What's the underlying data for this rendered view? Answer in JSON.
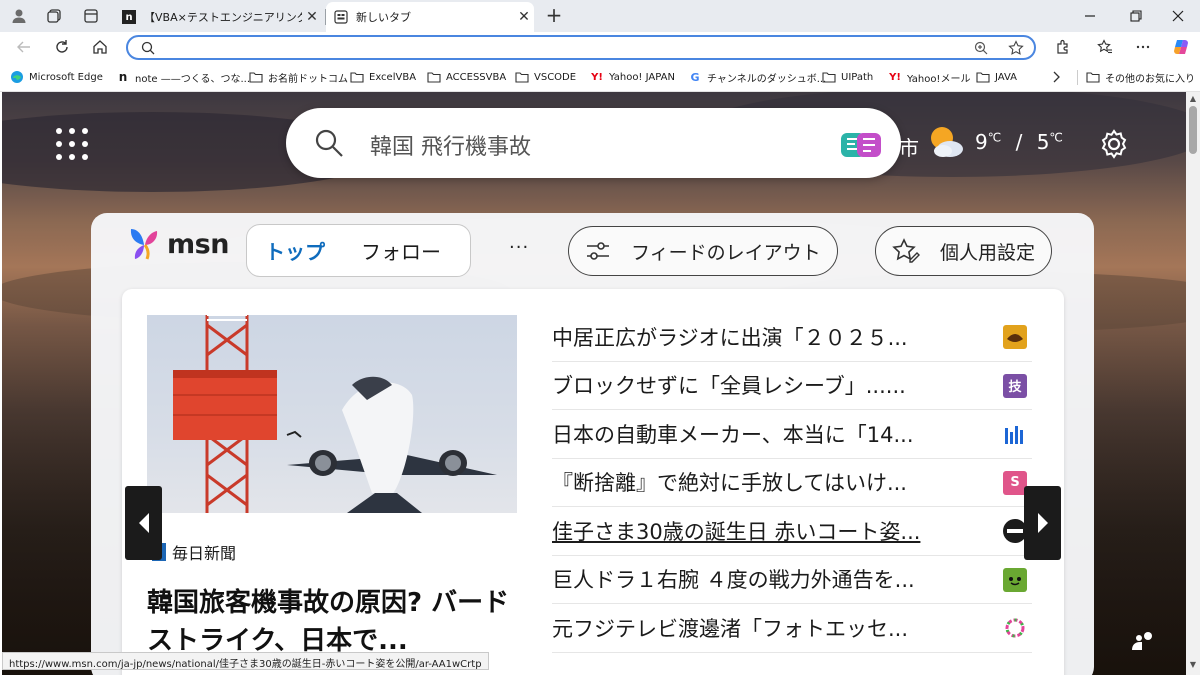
{
  "tabs": [
    {
      "title": "【VBA×テストエンジニアリング】エビデ",
      "active": false,
      "favicon": "n"
    },
    {
      "title": "新しいタブ",
      "active": true
    }
  ],
  "toolbar": {
    "address_value": "",
    "address_placeholder": ""
  },
  "bookmarks": [
    {
      "label": "Microsoft Edge",
      "icon": "edge-icon"
    },
    {
      "label": "note ——つくる、つな...",
      "icon": "note-icon"
    },
    {
      "label": "お名前ドットコム",
      "icon": "folder-icon"
    },
    {
      "label": "ExcelVBA",
      "icon": "folder-icon"
    },
    {
      "label": "ACCESSVBA",
      "icon": "folder-icon"
    },
    {
      "label": "VSCODE",
      "icon": "folder-icon"
    },
    {
      "label": "Yahoo! JAPAN",
      "icon": "yahoo-icon"
    },
    {
      "label": "チャンネルのダッシュボ...",
      "icon": "google-icon"
    },
    {
      "label": "UIPath",
      "icon": "folder-icon"
    },
    {
      "label": "Yahoo!メール",
      "icon": "yahoo-icon"
    },
    {
      "label": "JAVA",
      "icon": "folder-icon"
    }
  ],
  "other_favorites": "その他のお気に入り",
  "search": {
    "text": "韓国 飛行機事故"
  },
  "weather": {
    "city_fragment": "市",
    "high": "9",
    "low": "5",
    "unit": "℃",
    "sep": "/"
  },
  "feed": {
    "logo_text": "msn",
    "pivot": [
      "トップ",
      "フォロー"
    ],
    "more": "···",
    "layout_button": "フィードのレイアウト",
    "personalize_button": "個人用設定",
    "hero": {
      "source": "毎日新聞",
      "title": "韓国旅客機事故の原因? バードストライク、日本で..."
    },
    "news": [
      {
        "text": "中居正広がラジオに出演「２０２５...",
        "icon": "orange-source-icon",
        "color": "#e2a21c"
      },
      {
        "text": "ブロックせずに「全員レシーブ」......",
        "icon": "purple-source-icon",
        "color": "#7b4fa5"
      },
      {
        "text": "日本の自動車メーカー、本当に「14...",
        "icon": "barchart-source-icon",
        "color": "#1c66d5"
      },
      {
        "text": "『断捨離』で絶対に手放してはいけ...",
        "icon": "s-source-icon",
        "color": "#e0558a"
      },
      {
        "text": "佳子さま30歳の誕生日 赤いコート姿...",
        "icon": "black-source-icon",
        "color": "#1b1b1b",
        "underline": true
      },
      {
        "text": "巨人ドラ１右腕 ４度の戦力外通告を...",
        "icon": "green-source-icon",
        "color": "#6aa832"
      },
      {
        "text": "元フジテレビ渡邊渚「フォトエッセ...",
        "icon": "ring-source-icon",
        "color": "#ffffff"
      }
    ]
  },
  "status_url": "https://www.msn.com/ja-jp/news/national/佳子さま30歳の誕生日-赤いコート姿を公開/ar-AA1wCrtp"
}
